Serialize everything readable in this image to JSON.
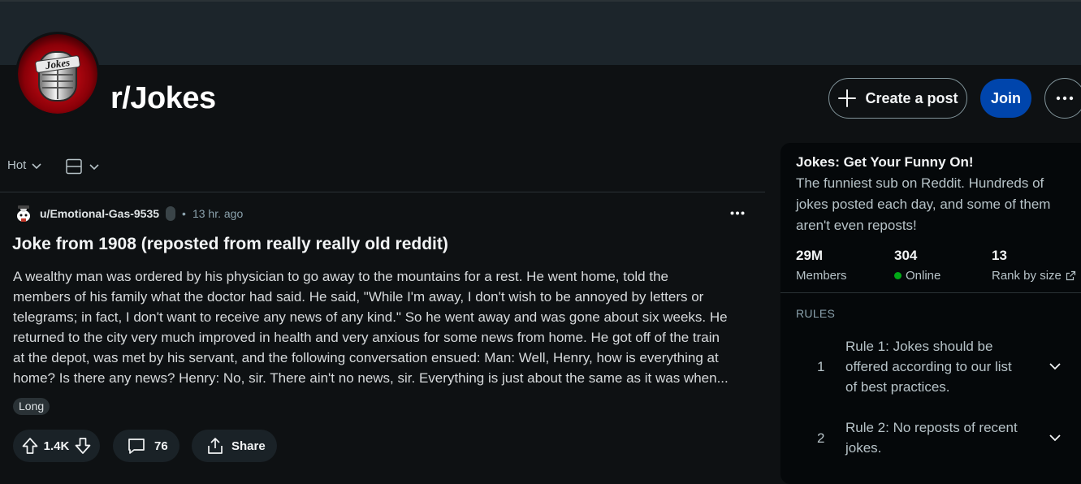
{
  "subreddit": {
    "name": "r/Jokes",
    "avatar_text": "Jokes"
  },
  "header_actions": {
    "create_post": "Create a post",
    "join": "Join"
  },
  "feed_controls": {
    "sort": "Hot"
  },
  "post": {
    "author": "u/Emotional-Gas-9535",
    "separator": "•",
    "time": "13 hr. ago",
    "title": "Joke from 1908 (reposted from really really old reddit)",
    "body_lines": [
      "A wealthy man was ordered by his physician to go away to the mountains for a rest. He went home, told the",
      "members of his family what the doctor had said. He said, \"While I'm away, I don't wish to be annoyed by letters or",
      "telegrams; in fact, I don't want to receive any news of any kind.\" So he went away and was gone about six weeks. He",
      "returned to the city very much improved in health and very anxious for some news from home. He got off of the train",
      "at the depot, was met by his servant, and the following conversation ensued: Man: Well, Henry, how is everything at",
      "home? Is there any news? Henry: No, sir. There ain't no news, sir. Everything is just about the same as it was when..."
    ],
    "flair": "Long",
    "votes": "1.4K",
    "comments": "76",
    "share": "Share"
  },
  "sidebar": {
    "title": "Jokes: Get Your Funny On!",
    "description_lines": [
      "The funniest sub on Reddit. Hundreds of",
      "jokes posted each day, and some of them",
      "aren't even reposts!"
    ],
    "stats": {
      "members": {
        "value": "29M",
        "label": "Members"
      },
      "online": {
        "value": "304",
        "label": "Online",
        "color": "#01a816"
      },
      "rank": {
        "value": "13",
        "label": "Rank by size"
      }
    },
    "rules_heading": "RULES",
    "rules": [
      {
        "index": "1",
        "lines": [
          "Rule 1: Jokes should be",
          "offered according to our list",
          "of best practices."
        ]
      },
      {
        "index": "2",
        "lines": [
          "Rule 2: No reposts of recent",
          "jokes."
        ]
      }
    ]
  },
  "colors": {
    "background": "#0e1113",
    "join_button": "#0045ac",
    "banner": "#1c252b"
  }
}
